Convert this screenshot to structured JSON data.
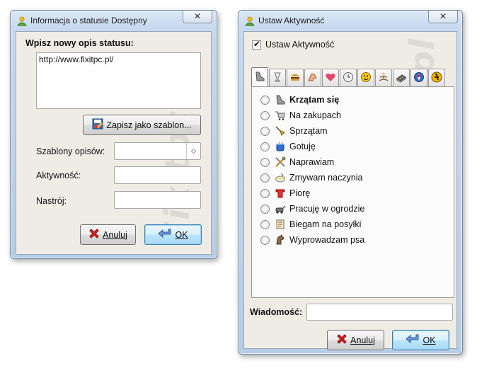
{
  "left_window": {
    "title": "Informacja o statusie Dostępny",
    "close_label": "✕",
    "heading": "Wpisz nowy opis statusu:",
    "status_text": "http://www.fixitpc.pl/",
    "save_template_label": "Zapisz jako szablon...",
    "templates_label": "Szablony opisów:",
    "activity_label": "Aktywność:",
    "mood_label": "Nastrój:",
    "cancel_label": "Anuluj",
    "ok_label": "OK",
    "watermark": "Fixitpc.pl"
  },
  "right_window": {
    "title": "Ustaw Aktywność",
    "close_label": "✕",
    "checkbox_label": "Ustaw Aktywność",
    "checkbox_checked": true,
    "tabs": [
      {
        "icon": "shoe-icon"
      },
      {
        "icon": "glass-icon"
      },
      {
        "icon": "burger-icon"
      },
      {
        "icon": "muscle-arm-icon"
      },
      {
        "icon": "hearts-icon"
      },
      {
        "icon": "clock-icon"
      },
      {
        "icon": "smiley-icon"
      },
      {
        "icon": "meditation-icon"
      },
      {
        "icon": "book-icon"
      },
      {
        "icon": "compass-icon"
      },
      {
        "icon": "work-sign-icon"
      }
    ],
    "activities": [
      {
        "label": "Krzątam się",
        "icon": "shoe-icon",
        "bold": true
      },
      {
        "label": "Na zakupach",
        "icon": "shopping-cart-icon",
        "bold": false
      },
      {
        "label": "Sprzątam",
        "icon": "broom-icon",
        "bold": false
      },
      {
        "label": "Gotuję",
        "icon": "cooking-pot-icon",
        "bold": false
      },
      {
        "label": "Naprawiam",
        "icon": "tools-icon",
        "bold": false
      },
      {
        "label": "Zmywam naczynia",
        "icon": "dishes-icon",
        "bold": false
      },
      {
        "label": "Piorę",
        "icon": "laundry-icon",
        "bold": false
      },
      {
        "label": "Pracuję w ogrodzie",
        "icon": "garden-icon",
        "bold": false
      },
      {
        "label": "Biegam na posyłki",
        "icon": "errands-icon",
        "bold": false
      },
      {
        "label": "Wyprowadzam psa",
        "icon": "dog-icon",
        "bold": false
      }
    ],
    "message_label": "Wiadomość:",
    "message_value": "",
    "cancel_label": "Anuluj",
    "ok_label": "OK",
    "watermark": "Fixitpc.pl"
  },
  "colors": {
    "frame": "#c6d9ee",
    "client": "#efece5",
    "default_button": "#bee6fd"
  }
}
